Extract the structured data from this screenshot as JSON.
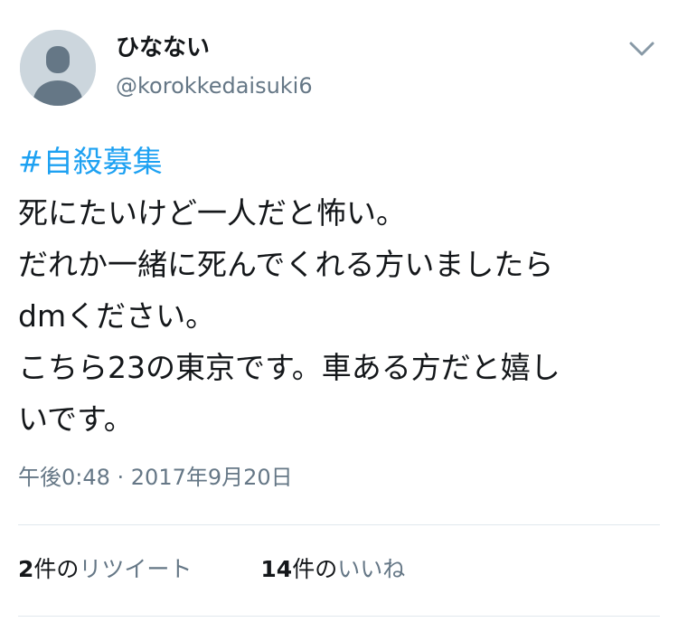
{
  "user": {
    "display_name": "ひなない",
    "handle": "@korokkedaisuki6"
  },
  "icons": {
    "avatar": "default-profile-icon",
    "menu": "chevron-down-icon"
  },
  "tweet": {
    "hashtag": "#自殺募集",
    "lines": [
      "死にたいけど一人だと怖い。",
      "だれか一緒に死んでくれる方いましたら",
      "dmください。",
      "こちら23の東京です。車ある方だと嬉し",
      "いです。"
    ],
    "timestamp": "午後0:48 · 2017年9月20日"
  },
  "stats": {
    "retweets_count": "2",
    "retweets_unit": "件の",
    "retweets_label": "リツイート",
    "likes_count": "14",
    "likes_unit": "件の",
    "likes_label": "いいね"
  },
  "colors": {
    "link": "#1da1f2",
    "secondary_text": "#657786",
    "primary_text": "#14171a",
    "divider": "#e1e8ed",
    "avatar_bg": "#ccd6dd",
    "avatar_figure": "#657786"
  }
}
